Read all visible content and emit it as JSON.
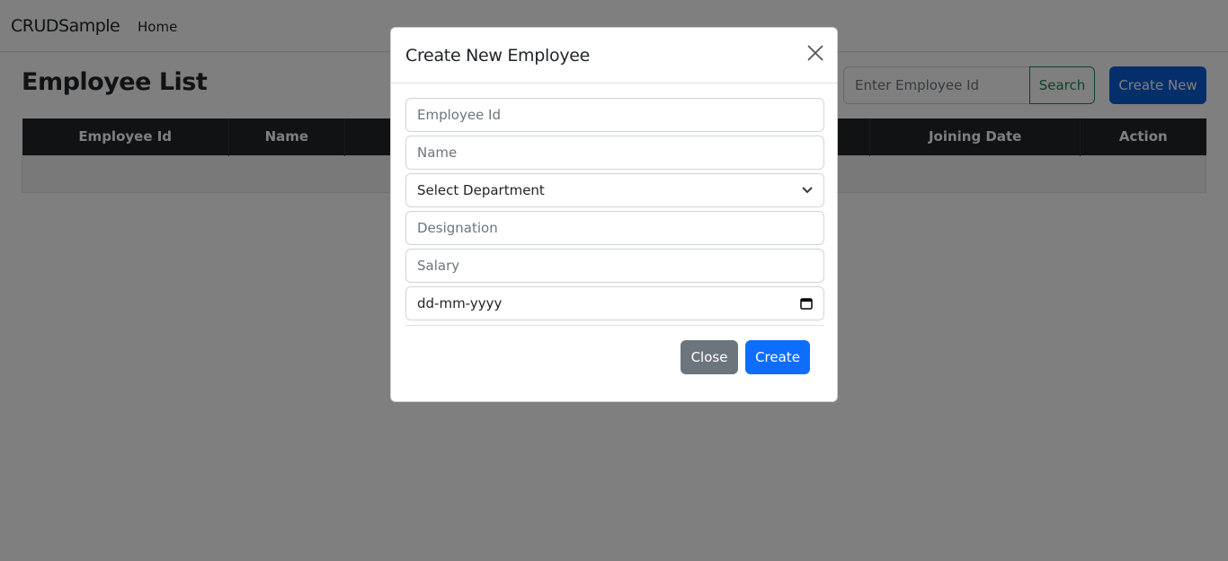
{
  "navbar": {
    "brand": "CRUDSample",
    "links": [
      {
        "label": "Home"
      }
    ]
  },
  "page": {
    "title": "Employee List",
    "search_placeholder": "Enter Employee Id",
    "search_label": "Search",
    "create_new_label": "Create New"
  },
  "table": {
    "headers": [
      "Employee Id",
      "Name",
      "Joining Date",
      "Action"
    ]
  },
  "modal": {
    "title": "Create New Employee",
    "fields": {
      "employee_id_placeholder": "Employee Id",
      "name_placeholder": "Name",
      "department_selected": "Select Department",
      "designation_placeholder": "Designation",
      "salary_placeholder": "Salary",
      "date_placeholder": "dd-mm-yyyy"
    },
    "close_label": "Close",
    "create_label": "Create"
  },
  "colors": {
    "primary": "#0d6efd",
    "secondary": "#6c757d",
    "success": "#198754",
    "table_header": "#212529"
  }
}
